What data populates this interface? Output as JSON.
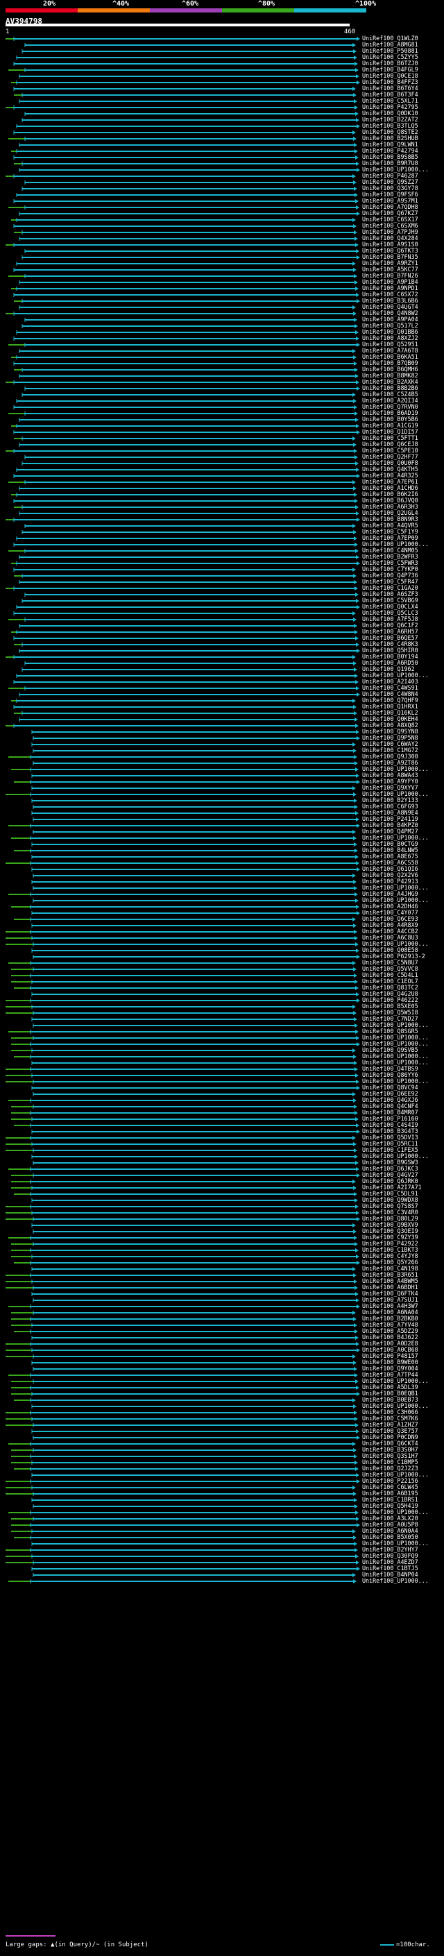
{
  "header": {
    "query_name": "AV394798",
    "query_start": "1",
    "query_end": "460",
    "identity_scale": [
      {
        "label": "20%",
        "color": "#e4001e"
      },
      {
        "label": "^40%",
        "color": "#f07a10"
      },
      {
        "label": "^60%",
        "color": "#a040b8"
      },
      {
        "label": "^80%",
        "color": "#3aa81c"
      },
      {
        "label": "^100%",
        "color": "#1ab7cf"
      }
    ]
  },
  "colors": {
    "background": "#000000",
    "query_bar": "#ffffff",
    "hit_high": "#1ab7cf",
    "hit_medium": "#3aa81c",
    "gap": "#c040c0",
    "label": "#ffffff"
  },
  "hits": [
    "UniRef100_Q1WLZ0",
    "UniRef100_A8MG81",
    "UniRef100_P50881",
    "UniRef100_C5ZYY5",
    "UniRef100_B6TZJ0",
    "UniRef100_B4FGL9",
    "UniRef100_Q0CE18",
    "UniRef100_B4FFZ3",
    "UniRef100_B6T6Y4",
    "UniRef100_B6T3F4",
    "UniRef100_C5XL71",
    "UniRef100_P42795",
    "UniRef100_Q0DK10",
    "UniRef100_B2ZAT2",
    "UniRef100_B3TLQ5",
    "UniRef100_Q8STE2",
    "UniRef100_B2SHUB",
    "UniRef100_Q9LWN1",
    "UniRef100_P42794",
    "UniRef100_B9S8B5",
    "UniRef100_B9R7U8",
    "UniRef100_UP1000...",
    "UniRef100_P46287",
    "UniRef100_Q9SZ27",
    "UniRef100_Q3GY78",
    "UniRef100_Q9FSF6",
    "UniRef100_A9S7M1",
    "UniRef100_A7QDH8",
    "UniRef100_Q67KZ7",
    "UniRef100_C6SX17",
    "UniRef100_C6SXM6",
    "UniRef100_A7PJH9",
    "UniRef100_Q4X284",
    "UniRef100_A9S1S0",
    "UniRef100_Q6TKT3",
    "UniRef100_B7FN35",
    "UniRef100_A9RZY1",
    "UniRef100_A5KC77",
    "UniRef100_B7FN26",
    "UniRef100_A9P1B4",
    "UniRef100_A9NPD1",
    "UniRef100_C6SX72",
    "UniRef100_B3L6B6",
    "UniRef100_Q4UGT4",
    "UniRef100_Q4N8W2",
    "UniRef100_A9PA04",
    "UniRef100_Q517L2",
    "UniRef100_Q01BB6",
    "UniRef100_A8XZJ2",
    "UniRef100_Q52951",
    "UniRef100_A7A6T8",
    "UniRef100_B6KA51",
    "UniRef100_B7QB09",
    "UniRef100_B6QMH6",
    "UniRef100_B8MK82",
    "UniRef100_B2AXK4",
    "UniRef100_B8B2B6",
    "UniRef100_C5Z4B5",
    "UniRef100_A2QI34",
    "UniRef100_Q7RVN0",
    "UniRef100_B6AD19",
    "UniRef100_B0Y5B6",
    "UniRef100_A1CG19",
    "UniRef100_Q1DI57",
    "UniRef100_C5FTT1",
    "UniRef100_Q6CEJ8",
    "UniRef100_C5PE10",
    "UniRef100_Q2HF77",
    "UniRef100_Q0U0F8",
    "UniRef100_Q4KTH5",
    "UniRef100_A4R325",
    "UniRef100_A7EP61",
    "UniRef100_A1CHD6",
    "UniRef100_B6K2I6",
    "UniRef100_B6JVQ0",
    "UniRef100_A6R3H3",
    "UniRef100_Q2UGL4",
    "UniRef100_B8N9R3",
    "UniRef100_A4QVR5",
    "UniRef100_C5F1Y9",
    "UniRef100_A7EP09",
    "UniRef100_UP1000...",
    "UniRef100_C4NM05",
    "UniRef100_B2WFR3",
    "UniRef100_C5FWR3",
    "UniRef100_C7YKP0",
    "UniRef100_Q4P736",
    "UniRef100_C5FR47",
    "UniRef100_C1GA20",
    "UniRef100_A6SZF3",
    "UniRef100_C5VBG9",
    "UniRef100_Q0CLX4",
    "UniRef100_Q5CLC3",
    "UniRef100_A7F5J8",
    "UniRef100_Q6C1F2",
    "UniRef100_A6RH57",
    "UniRef100_B6QE57",
    "UniRef100_C4R8K3",
    "UniRef100_Q5HIR0",
    "UniRef100_B0Y194",
    "UniRef100_A6RD50",
    "UniRef100_Q1962",
    "UniRef100_UP1000...",
    "UniRef100_A2I403",
    "UniRef100_C4WS91",
    "UniRef100_C4W8N4",
    "UniRef100_Q7QHF9",
    "UniRef100_Q1HRX1",
    "UniRef100_Q16KL2",
    "UniRef100_Q0KEH4",
    "UniRef100_A8XQ82",
    "UniRef100_Q9SYN8",
    "UniRef100_Q9P5N8",
    "UniRef100_C6WAY2",
    "UniRef100_C1MG72",
    "UniRef100_Q9J300",
    "UniRef100_A9ZT86",
    "UniRef100_UP1000...",
    "UniRef100_A8WA43",
    "UniRef100_A9YFY0",
    "UniRef100_Q9XYV7",
    "UniRef100_UP1000...",
    "UniRef100_B2Y133",
    "UniRef100_C6FG93",
    "UniRef100_A8N9E4",
    "UniRef100_P24119",
    "UniRef100_B4KPZ0",
    "UniRef100_Q4PM27",
    "UniRef100_UP1000...",
    "UniRef100_B0CTG9",
    "UniRef100_B4LNW5",
    "UniRef100_A8E675",
    "UniRef100_A6CS58",
    "UniRef100_Q61QI6",
    "UniRef100_Q2X2V6",
    "UniRef100_P42913",
    "UniRef100_UP1000...",
    "UniRef100_A4JHG9",
    "UniRef100_UP1000...",
    "UniRef100_A2DH46",
    "UniRef100_C4Y077",
    "UniRef100_Q6CE93",
    "UniRef100_A4R8X9",
    "UniRef100_A4CCB2",
    "UniRef100_A6C8U3",
    "UniRef100_UP1000...",
    "UniRef100_Q08E58",
    "UniRef100_P62913-2",
    "UniRef100_C5N8U7",
    "UniRef100_Q5VVC8",
    "UniRef100_C5D4L1",
    "UniRef100_C1EOL7",
    "UniRef100_Q81TC2",
    "UniRef100_Q4G2U8",
    "UniRef100_P46222",
    "UniRef100_B5XE05",
    "UniRef100_Q5W5I8",
    "UniRef100_C7ND27",
    "UniRef100_UP1000...",
    "UniRef100_Q8SGR5",
    "UniRef100_UP1000...",
    "UniRef100_UP1000...",
    "UniRef100_Q9SVB5",
    "UniRef100_UP1000...",
    "UniRef100_UP1000...",
    "UniRef100_Q4TBS9",
    "UniRef100_Q86YY6",
    "UniRef100_UP1000...",
    "UniRef100_Q8VC94",
    "UniRef100_Q6EE92",
    "UniRef100_Q4GXJ6",
    "UniRef100_Q4CNF4",
    "UniRef100_B4MR07",
    "UniRef100_P16160",
    "UniRef100_C4S4I9",
    "UniRef100_B3G4T3",
    "UniRef100_Q5DVI3",
    "UniRef100_Q5RC11",
    "UniRef100_C1FEX5",
    "UniRef100_UP1000...",
    "UniRef100_B9GSW3",
    "UniRef100_Q6JKC3",
    "UniRef100_Q4GV27",
    "UniRef100_Q6JRK0",
    "UniRef100_A2I7A71",
    "UniRef100_C5DL91",
    "UniRef100_Q9WDX8",
    "UniRef100_Q7S8S7",
    "UniRef100_C3V4R0",
    "UniRef100_Q80L29",
    "UniRef100_Q9BXV9",
    "UniRef100_Q3OEI9",
    "UniRef100_C9ZY39",
    "UniRef100_P42922",
    "UniRef100_C1BKT3",
    "UniRef100_C4YJY8",
    "UniRef100_Q5Y266",
    "UniRef100_C4N198",
    "UniRef100_B3R651",
    "UniRef100_A4BWM5",
    "UniRef100_A6BDH1",
    "UniRef100_Q6FTK4",
    "UniRef100_A7SUJ1",
    "UniRef100_A4H3W7",
    "UniRef100_A6NA04",
    "UniRef100_B2BKB0",
    "UniRef100_A7YV48",
    "UniRef100_A5DZ29",
    "UniRef100_B4J622",
    "UniRef100_A0D2E8",
    "UniRef100_A0CB68",
    "UniRef100_P48157",
    "UniRef100_B9WE00",
    "UniRef100_Q9Y004",
    "UniRef100_A7TP44",
    "UniRef100_UP1000...",
    "UniRef100_A5DL39",
    "UniRef100_B0EQB1",
    "UniRef100_B0EB73",
    "UniRef100_UP1000...",
    "UniRef100_C3H066",
    "UniRef100_C5M7K6",
    "UniRef100_A1ZHZ7",
    "UniRef100_Q3E757",
    "UniRef100_P0CDN9",
    "UniRef100_Q6CKT4",
    "UniRef100_B3S0H7",
    "UniRef100_Q3S1H7",
    "UniRef100_C1BMP5",
    "UniRef100_Q2J2Z3",
    "UniRef100_UP1000...",
    "UniRef100_P22156",
    "UniRef100_C6LW45",
    "UniRef100_A6B195",
    "UniRef100_C1BRS1",
    "UniRef100_Q5H419",
    "UniRef100_UP1000...",
    "UniRef100_A3LX20",
    "UniRef100_A0U5P8",
    "UniRef100_A6N0A4",
    "UniRef100_B5X050",
    "UniRef100_UP1000...",
    "UniRef100_B2YHY7",
    "UniRef100_Q30FQ9",
    "UniRef100_A4EZD7",
    "UniRef100_C1BTJ5",
    "UniRef100_B4NP04",
    "UniRef100_UP1000..."
  ],
  "legend": {
    "large_gaps_text": "Large gaps: ▲(in Query)/~ (in Subject)",
    "scale_text": "=100char."
  }
}
